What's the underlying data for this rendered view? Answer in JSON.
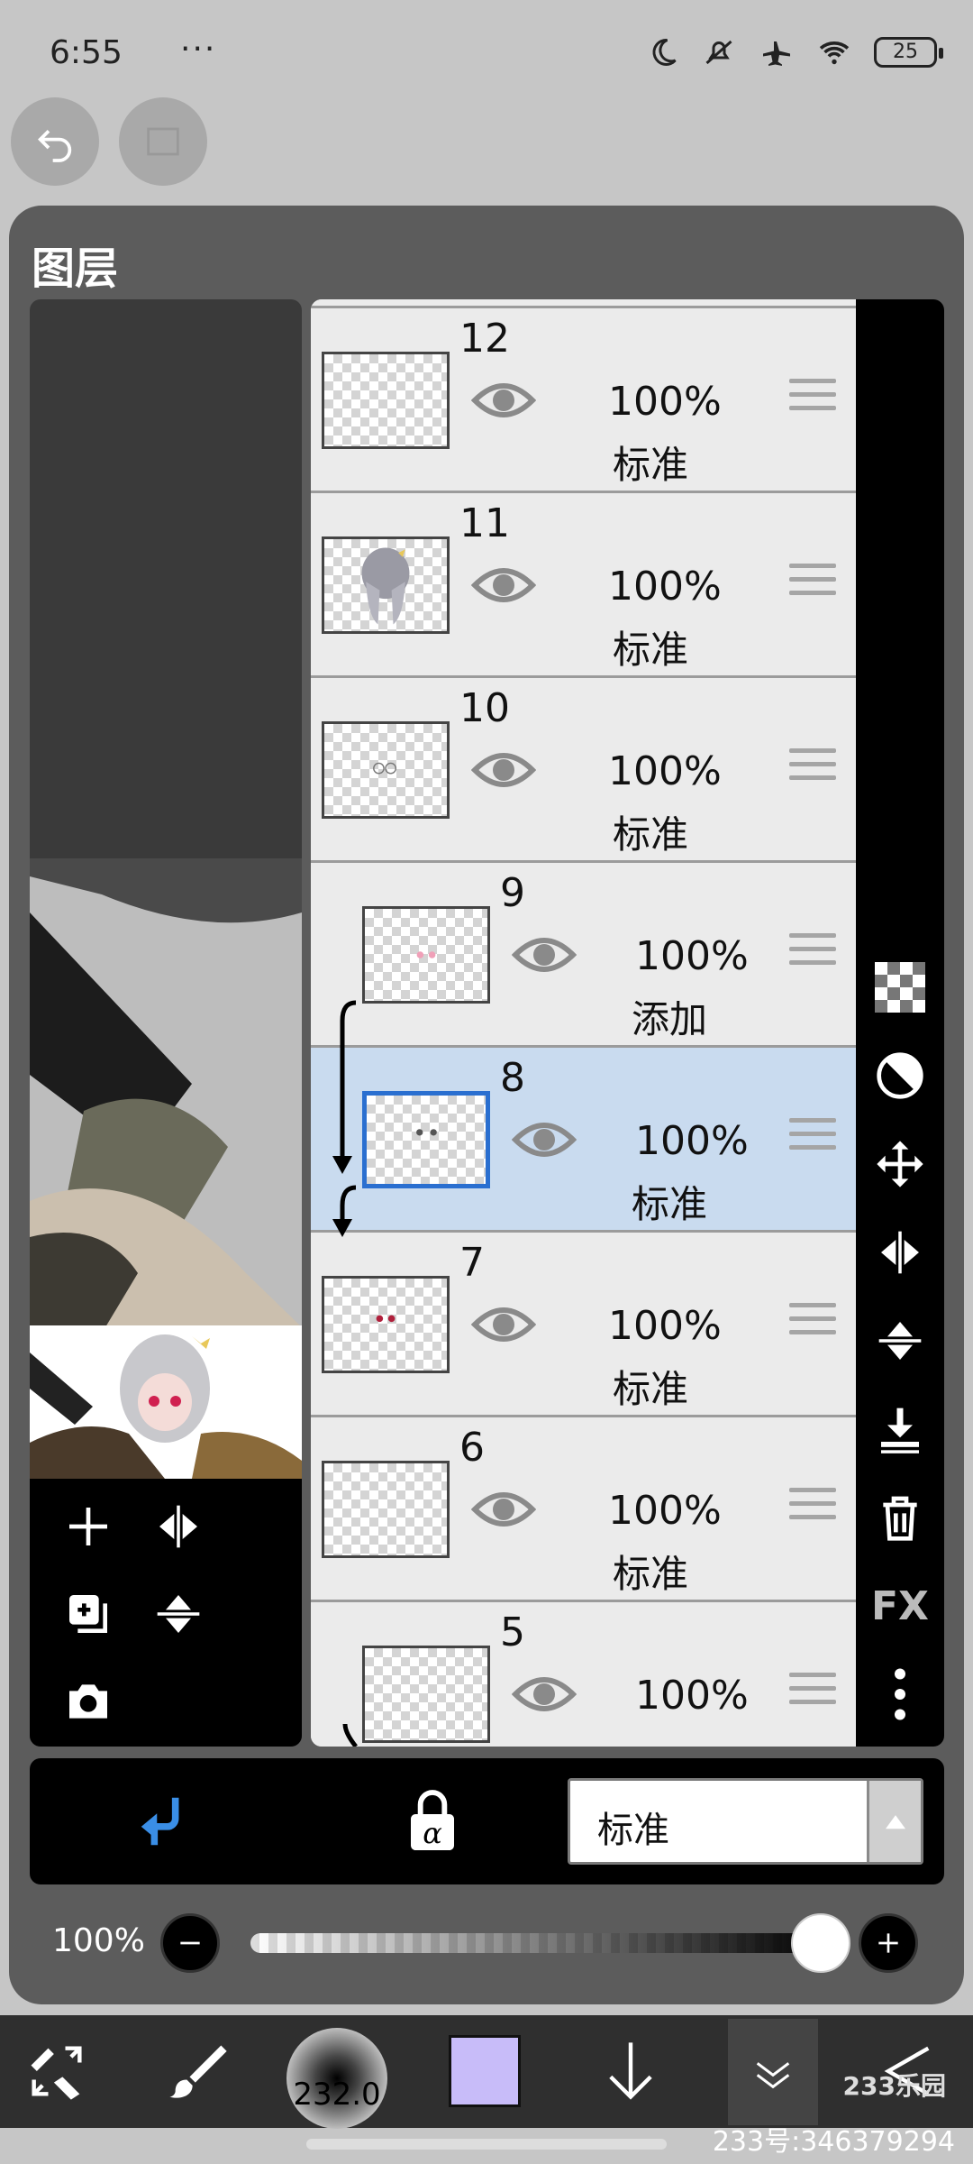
{
  "status": {
    "time": "6:55",
    "dots": "···",
    "battery": "25"
  },
  "panel": {
    "title": "图层"
  },
  "layers": [
    {
      "num": "12",
      "opacity": "100%",
      "blend": "标准",
      "indent": false,
      "selected": false,
      "thumb": "empty"
    },
    {
      "num": "11",
      "opacity": "100%",
      "blend": "标准",
      "indent": false,
      "selected": false,
      "thumb": "hair"
    },
    {
      "num": "10",
      "opacity": "100%",
      "blend": "标准",
      "indent": false,
      "selected": false,
      "thumb": "face"
    },
    {
      "num": "9",
      "opacity": "100%",
      "blend": "添加",
      "indent": true,
      "selected": false,
      "thumb": "blush"
    },
    {
      "num": "8",
      "opacity": "100%",
      "blend": "标准",
      "indent": true,
      "selected": true,
      "thumb": "eyes-dark"
    },
    {
      "num": "7",
      "opacity": "100%",
      "blend": "标准",
      "indent": false,
      "selected": false,
      "thumb": "eyes-red"
    },
    {
      "num": "6",
      "opacity": "100%",
      "blend": "标准",
      "indent": false,
      "selected": false,
      "thumb": "empty"
    },
    {
      "num": "5",
      "opacity": "100%",
      "blend": "",
      "indent": true,
      "selected": false,
      "thumb": "empty"
    }
  ],
  "blend_bar": {
    "mode": "标准"
  },
  "opacity": {
    "label": "100%",
    "value": 1.0
  },
  "bottom": {
    "brush_size": "232.0",
    "color": "#c8bcf9"
  },
  "watermark": "233号:346379294",
  "logo": "233乐园",
  "icons": {
    "undo": "undo-icon",
    "redo": "redo-icon",
    "add": "add-layer-icon",
    "flip_h": "flip-horizontal-icon",
    "duplicate": "duplicate-layer-icon",
    "flip_v": "flip-vertical-icon",
    "camera": "camera-icon",
    "clip": "clipping-icon",
    "alpha_lock": "alpha-lock-icon",
    "fx": "FX"
  }
}
